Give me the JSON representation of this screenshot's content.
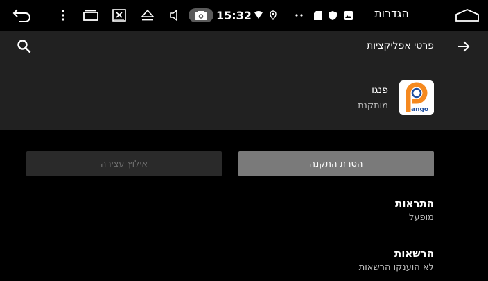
{
  "status_bar": {
    "time": "15:32",
    "settings_title": "הגדרות",
    "icons": [
      "back-icon",
      "menu-dots-icon",
      "recents-icon",
      "close-window-icon",
      "eject-icon",
      "volume-icon",
      "camera-icon",
      "wifi-icon",
      "location-icon",
      "dots-icon",
      "sd-card-icon",
      "shield-icon",
      "image-icon",
      "home-icon"
    ]
  },
  "app_bar": {
    "title": "פרטי אפליקציות",
    "icons": [
      "search-icon",
      "arrow-forward-icon"
    ]
  },
  "app": {
    "name": "פנגו",
    "status": "מותקנת",
    "icon_text": "ango",
    "icon_colors": {
      "ring": "#f5891f",
      "inner": "#1e4fa0"
    }
  },
  "buttons": {
    "uninstall": "הסרת התקנה",
    "force_stop": "אילוץ עצירה"
  },
  "preferences": [
    {
      "title": "התראות",
      "summary": "מופעל"
    },
    {
      "title": "הרשאות",
      "summary": "לא הוענקו הרשאות"
    }
  ]
}
